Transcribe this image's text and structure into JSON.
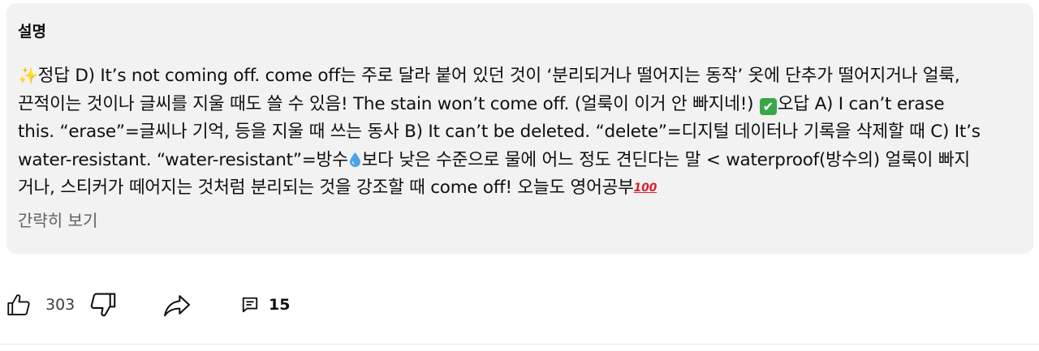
{
  "description": {
    "title": "설명",
    "lines": [
      [
        "정답 D) It’s not coming off. come off는 주로 달라 붙어 있던 것이 ‘분리되거나 떨어지는 동작’ 옷에 단추가 떨어지거나 얼룩,"
      ],
      [
        "끈적이는 것이나 글씨를 지울 때도 쓸 수 있음! The stain won’t come off. (얼룩이 이거 안 빠지네!) ",
        "오답 A) I can’t erase"
      ],
      [
        "this. “erase”=글씨나 기억, 등을 지울 때 쓰는 동사 B) It can’t be deleted. “delete”=디지털 데이터나 기록을 삭제할 때 C) It’s"
      ],
      [
        "water-resistant. “water-resistant”=방수",
        "보다 낮은 수준으로 물에 어느 정도 견딘다는 말 < waterproof(방수의) 얼룩이 빠지"
      ],
      [
        "거나, 스티커가 떼어지는 것처럼 분리되는 것을 강조할 때 come off! 오늘도 영어공부"
      ]
    ],
    "show_less_label": "간략히 보기"
  },
  "icons": {
    "sparkles": "sparkles-emoji",
    "check": "check-mark-button-emoji",
    "droplet": "droplet-emoji",
    "hundred": "hundred-points-emoji",
    "like": "thumbs-up-icon",
    "dislike": "thumbs-down-icon",
    "share": "share-icon",
    "comments": "comments-icon"
  },
  "emoji_glyphs": {
    "sparkles": "✨",
    "check": "✔",
    "hundred": "100"
  },
  "actions": {
    "like_count": "303",
    "comment_count": "15"
  }
}
